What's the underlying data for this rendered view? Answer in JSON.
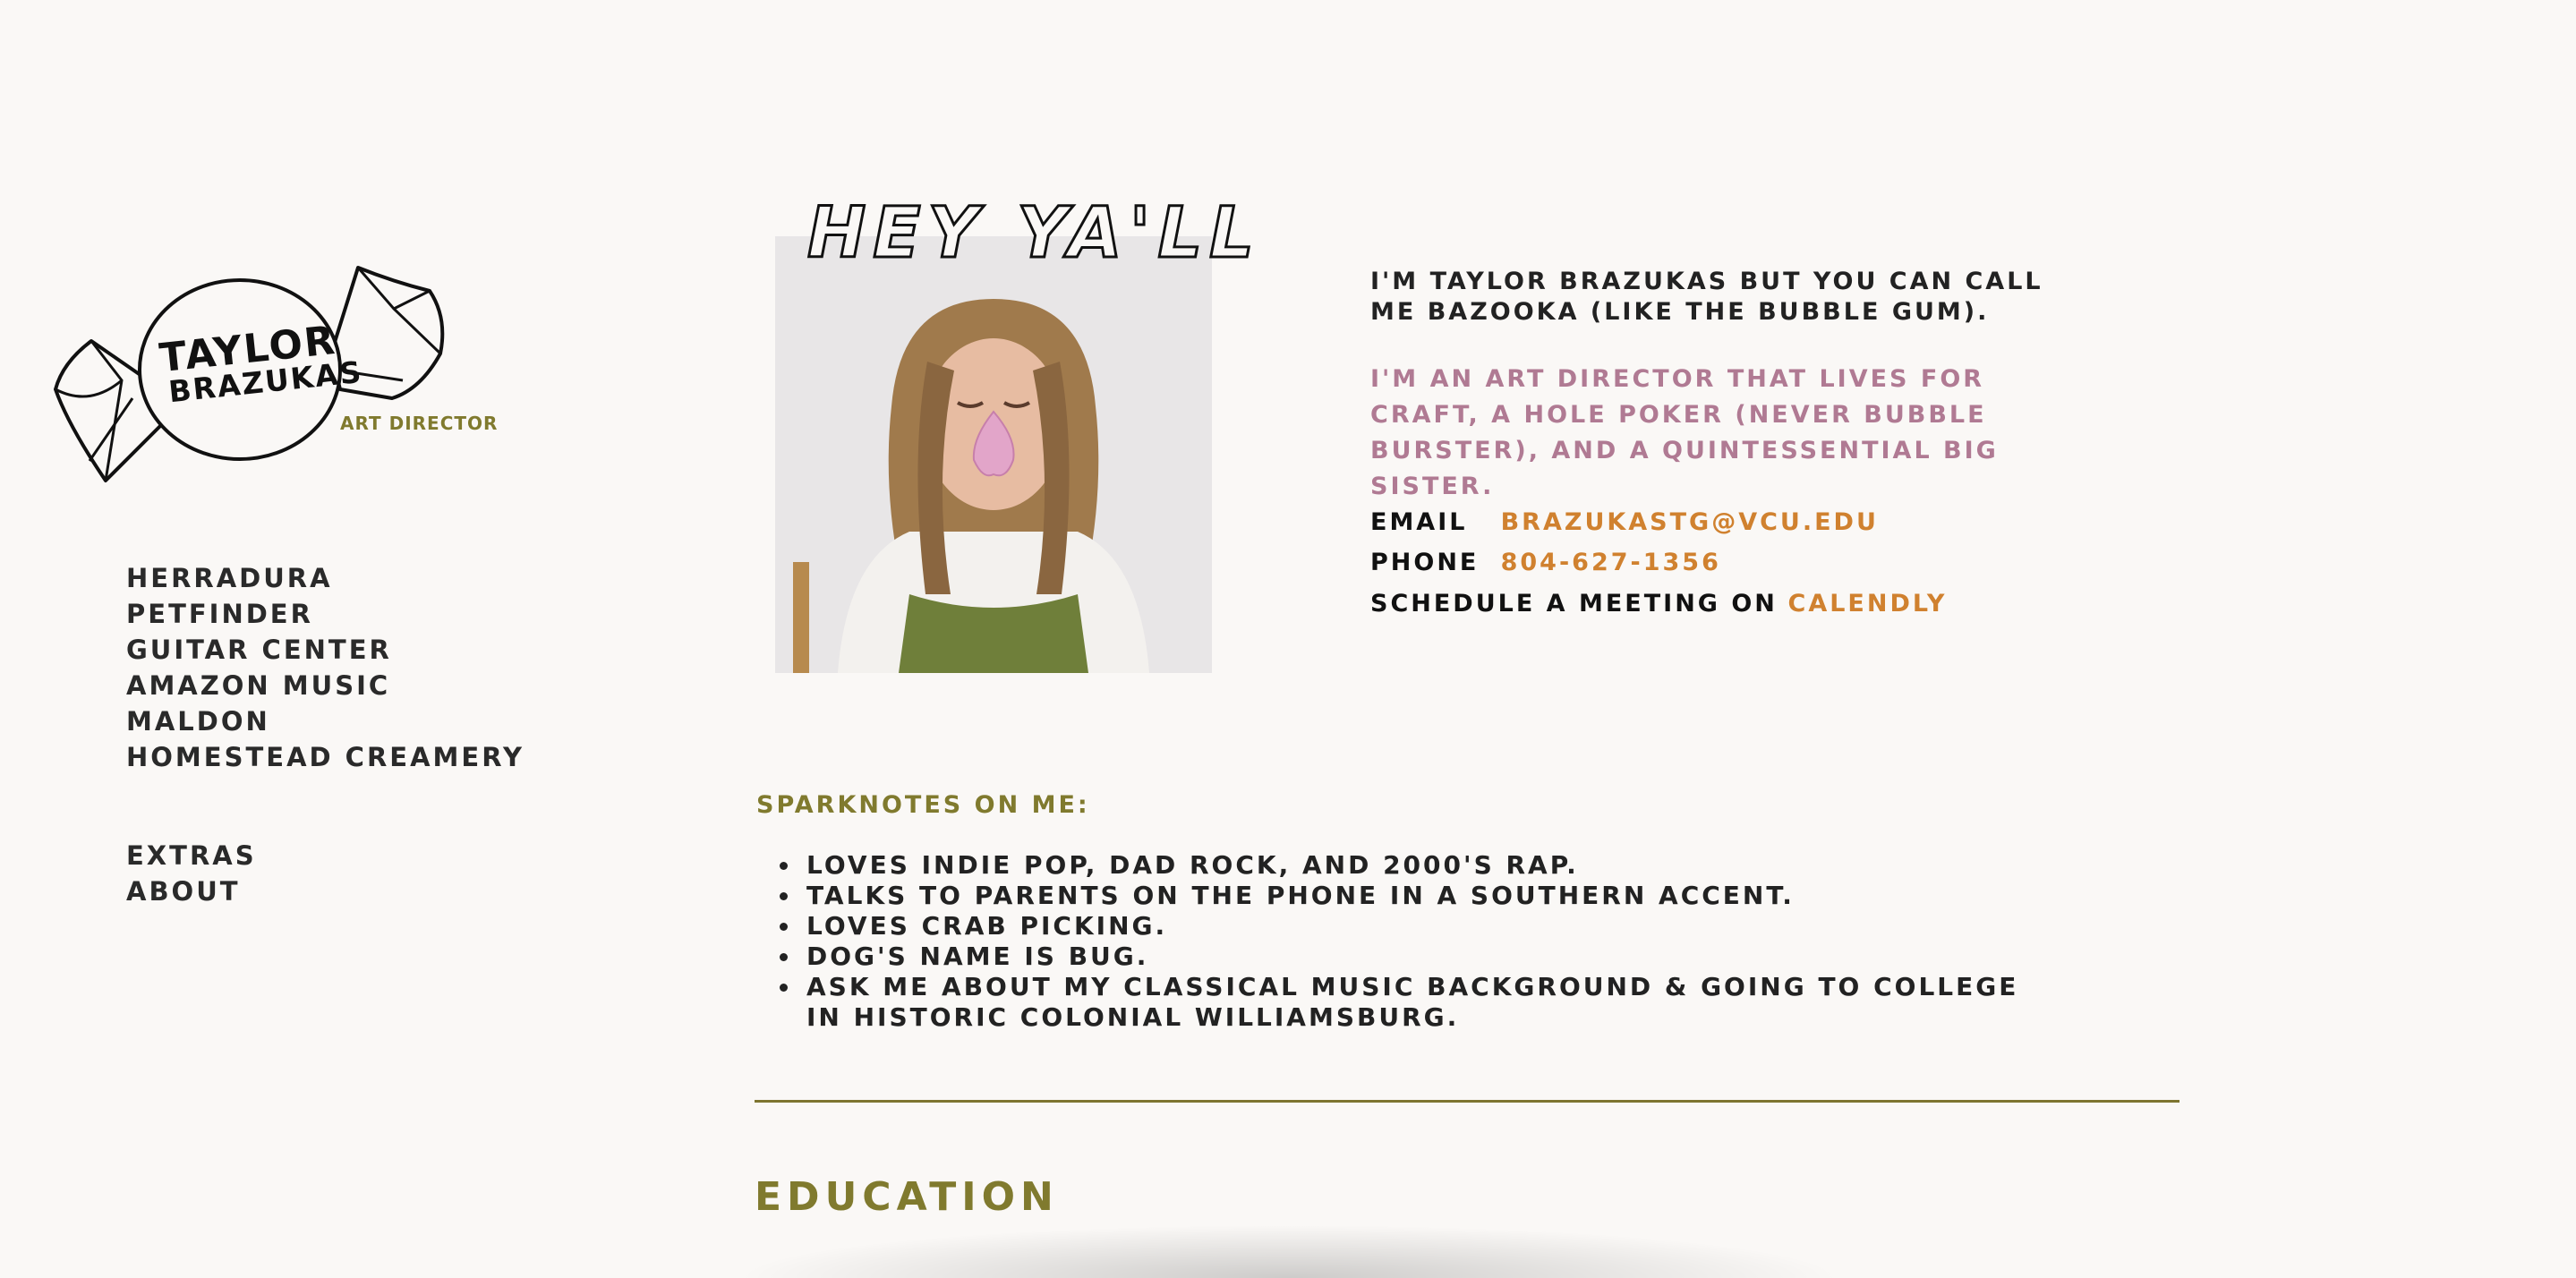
{
  "logo": {
    "name_line1": "TAYLOR",
    "name_line2": "BRAZUKAS",
    "subtitle": "ART DIRECTOR"
  },
  "nav": {
    "projects": [
      "HERRADURA",
      "PETFINDER",
      "GUITAR CENTER",
      "AMAZON MUSIC",
      "MALDON",
      "HOMESTEAD CREAMERY"
    ],
    "secondary": [
      "EXTRAS",
      "ABOUT"
    ]
  },
  "photo": {
    "headline": "HEY YA'LL"
  },
  "intro": {
    "line1": "I'M TAYLOR BRAZUKAS BUT YOU CAN CALL ME BAZOOKA (LIKE THE BUBBLE GUM).",
    "line2": "I'M AN ART DIRECTOR THAT LIVES FOR CRAFT, A HOLE POKER (NEVER BUBBLE BURSTER), AND A QUINTESSENTIAL BIG SISTER."
  },
  "contact": {
    "email_label": "EMAIL",
    "email_value": "BRAZUKASTG@VCU.EDU",
    "phone_label": "PHONE",
    "phone_value": "804-627-1356",
    "schedule_label": "SCHEDULE A MEETING ON",
    "schedule_link": "CALENDLY"
  },
  "sparknotes": {
    "title": "SPARKNOTES ON ME:",
    "items": [
      "LOVES INDIE POP, DAD ROCK, AND 2000'S RAP.",
      "TALKS TO PARENTS ON THE PHONE IN A SOUTHERN ACCENT.",
      "LOVES CRAB PICKING.",
      "DOG'S NAME IS BUG.",
      "ASK ME ABOUT MY CLASSICAL MUSIC BACKGROUND & GOING TO COLLEGE IN HISTORIC COLONIAL WILLIAMSBURG."
    ]
  },
  "education": {
    "title": "EDUCATION"
  },
  "colors": {
    "background": "#faf8f6",
    "olive": "#807a2e",
    "pink": "#b07a93",
    "orange": "#d0812f",
    "text": "#222222"
  }
}
